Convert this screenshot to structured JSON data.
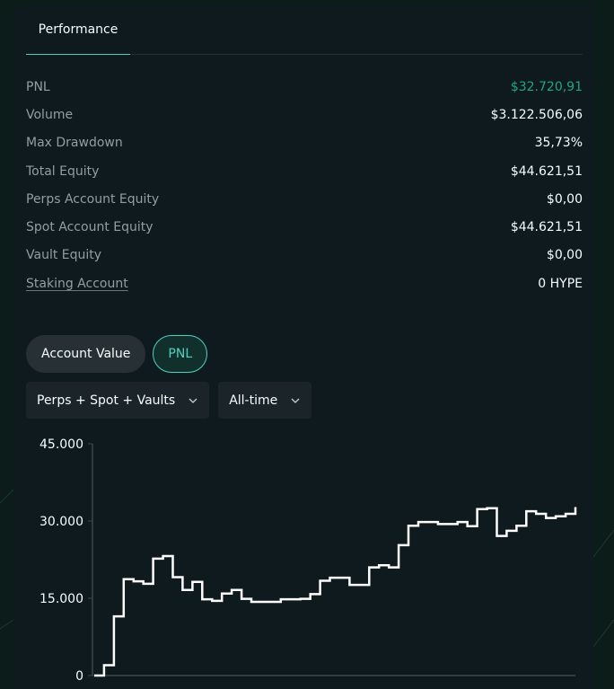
{
  "tabs": [
    {
      "label": "Performance"
    }
  ],
  "stats": [
    {
      "label": "PNL",
      "value": "$32.720,91",
      "color": "#1fa67d"
    },
    {
      "label": "Volume",
      "value": "$3.122.506,06"
    },
    {
      "label": "Max Drawdown",
      "value": "35,73%"
    },
    {
      "label": "Total Equity",
      "value": "$44.621,51"
    },
    {
      "label": "Perps Account Equity",
      "value": "$0,00"
    },
    {
      "label": "Spot Account Equity",
      "value": "$44.621,51"
    },
    {
      "label": "Vault Equity",
      "value": "$0,00"
    },
    {
      "label": "Staking Account",
      "value": "0 HYPE"
    }
  ],
  "chart_toggle": {
    "account_value_label": "Account Value",
    "pnl_label": "PNL",
    "active": "PNL"
  },
  "filters": {
    "scope": "Perps + Spot + Vaults",
    "range": "All-time"
  },
  "colors": {
    "accent": "#50d2c1",
    "positive": "#1fa67d",
    "line": "#ffffff"
  },
  "chart_data": {
    "type": "line",
    "title": "",
    "xlabel": "",
    "ylabel": "",
    "ylim": [
      0,
      45000
    ],
    "yticks": [
      "45.000",
      "30.000",
      "15.000",
      "0"
    ],
    "ytick_values": [
      45000,
      30000,
      15000,
      0
    ],
    "step": true,
    "series": [
      {
        "values": [
          0,
          2000,
          11500,
          18700,
          18300,
          17800,
          22700,
          23200,
          19100,
          16600,
          18200,
          14800,
          14500,
          15900,
          16600,
          14900,
          14300,
          14300,
          14300,
          14800,
          14800,
          14900,
          15800,
          18400,
          19000,
          19000,
          17600,
          17600,
          21000,
          21400,
          21000,
          25300,
          29100,
          29800,
          29800,
          29400,
          29400,
          29800,
          29000,
          32300,
          32500,
          27100,
          28100,
          29100,
          31900,
          31400,
          30600,
          30900,
          31400,
          32700
        ]
      }
    ]
  }
}
